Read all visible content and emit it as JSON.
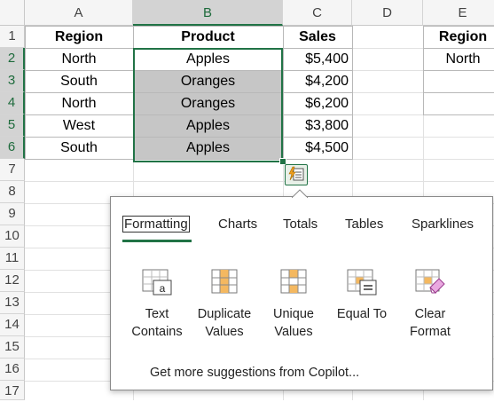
{
  "columns": [
    "A",
    "B",
    "C",
    "D",
    "E"
  ],
  "rows": [
    "1",
    "2",
    "3",
    "4",
    "5",
    "6",
    "7",
    "8",
    "9",
    "10",
    "11",
    "12",
    "13",
    "14",
    "15",
    "16",
    "17"
  ],
  "table": {
    "headers": [
      "Region",
      "Product",
      "Sales"
    ],
    "data": [
      [
        "North",
        "Apples",
        "$5,400"
      ],
      [
        "South",
        "Oranges",
        "$4,200"
      ],
      [
        "North",
        "Oranges",
        "$6,200"
      ],
      [
        "West",
        "Apples",
        "$3,800"
      ],
      [
        "South",
        "Apples",
        "$4,500"
      ]
    ]
  },
  "side_table": {
    "header": "Region",
    "values": [
      "North"
    ]
  },
  "quick_analysis": {
    "tabs": [
      "Formatting",
      "Charts",
      "Totals",
      "Tables",
      "Sparklines"
    ],
    "active_tab": "Formatting",
    "options": [
      {
        "icon": "text-contains-icon",
        "line1": "Text",
        "line2": "Contains"
      },
      {
        "icon": "duplicate-values-icon",
        "line1": "Duplicate",
        "line2": "Values"
      },
      {
        "icon": "unique-values-icon",
        "line1": "Unique",
        "line2": "Values"
      },
      {
        "icon": "equal-to-icon",
        "line1": "Equal To",
        "line2": ""
      },
      {
        "icon": "clear-format-icon",
        "line1": "Clear",
        "line2": "Format"
      }
    ],
    "more_link": "Get more suggestions from Copilot..."
  },
  "colors": {
    "accent": "#217346",
    "highlight": "#c6c6c6",
    "icon_orange": "#f4b860"
  }
}
